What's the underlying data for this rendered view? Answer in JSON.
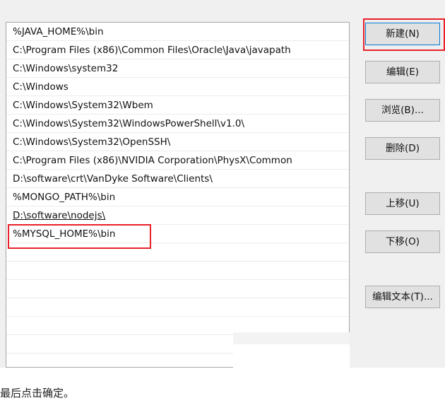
{
  "path_list": {
    "items": [
      "%JAVA_HOME%\\bin",
      "C:\\Program Files (x86)\\Common Files\\Oracle\\Java\\javapath",
      "C:\\Windows\\system32",
      "C:\\Windows",
      "C:\\Windows\\System32\\Wbem",
      "C:\\Windows\\System32\\WindowsPowerShell\\v1.0\\",
      "C:\\Windows\\System32\\OpenSSH\\",
      "C:\\Program Files (x86)\\NVIDIA Corporation\\PhysX\\Common",
      "D:\\software\\crt\\VanDyke Software\\Clients\\",
      "%MONGO_PATH%\\bin",
      "D:\\software\\nodejs\\",
      "%MYSQL_HOME%\\bin"
    ]
  },
  "buttons": {
    "new": "新建(N)",
    "edit": "编辑(E)",
    "browse": "浏览(B)...",
    "delete": "删除(D)",
    "move_up": "上移(U)",
    "move_down": "下移(O)",
    "edit_text": "编辑文本(T)..."
  },
  "caption": "最后点击确定。",
  "colors": {
    "highlight": "#e8212a",
    "dialog_background": "#f0f0f0",
    "button_background": "#e1e1e1"
  }
}
